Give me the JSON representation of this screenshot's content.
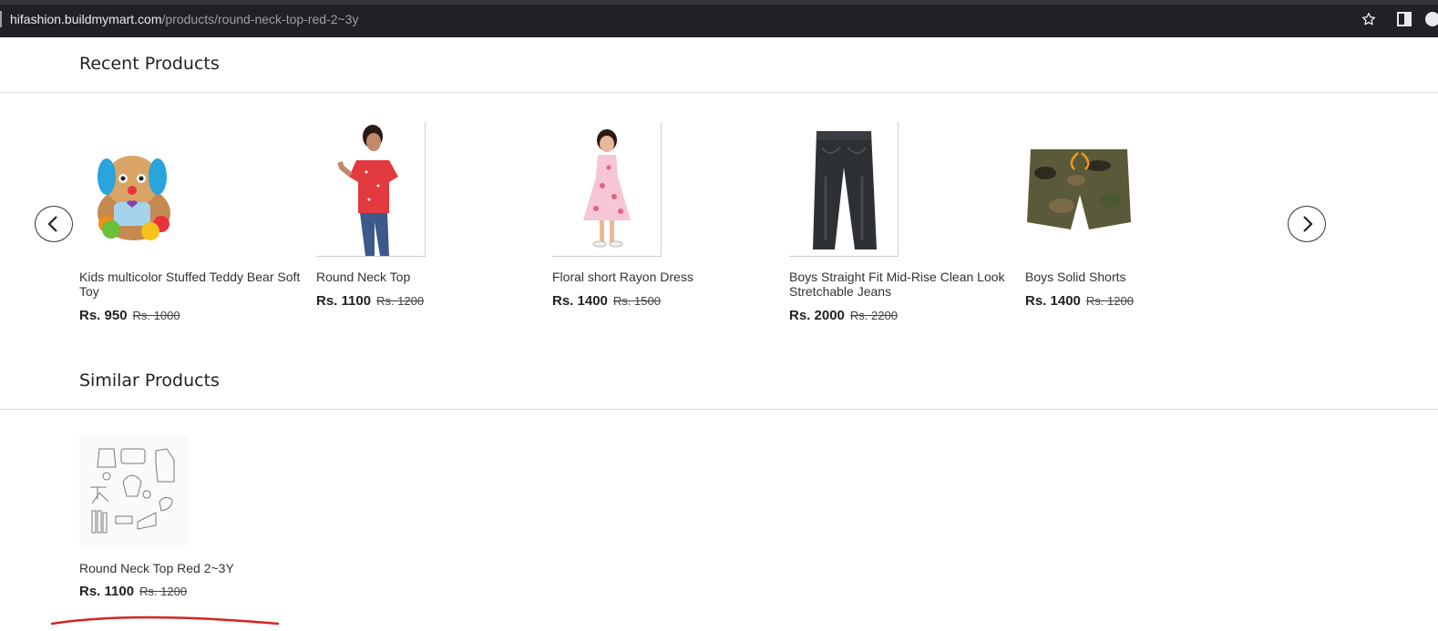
{
  "browser": {
    "url_host": "hifashion.buildmymart.com",
    "url_path": "/products/round-neck-top-red-2~3y",
    "icons": [
      "star-icon",
      "side-panel-icon",
      "profile-avatar"
    ]
  },
  "recent": {
    "title": "Recent Products",
    "products": [
      {
        "name": "Kids multicolor Stuffed Teddy Bear Soft Toy",
        "price": "Rs. 950",
        "old_price": "Rs. 1000"
      },
      {
        "name": "Round Neck Top",
        "price": "Rs. 1100",
        "old_price": "Rs. 1200"
      },
      {
        "name": "Floral short Rayon Dress",
        "price": "Rs. 1400",
        "old_price": "Rs. 1500"
      },
      {
        "name": "Boys Straight Fit Mid-Rise Clean Look Stretchable Jeans",
        "price": "Rs. 2000",
        "old_price": "Rs. 2200"
      },
      {
        "name": "Boys Solid Shorts",
        "price": "Rs. 1400",
        "old_price": "Rs. 1200"
      }
    ]
  },
  "similar": {
    "title": "Similar Products",
    "products": [
      {
        "name": "Round Neck Top Red 2~3Y",
        "price": "Rs. 1100",
        "old_price": "Rs. 1200"
      }
    ]
  },
  "colors": {
    "accent_mark": "#d62222",
    "browser_bar": "#202124"
  }
}
